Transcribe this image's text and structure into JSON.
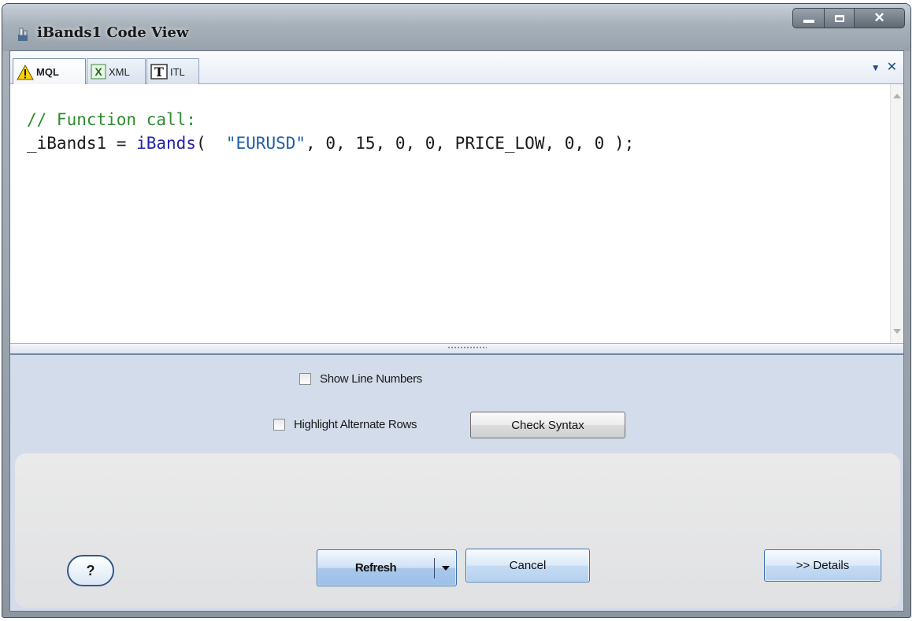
{
  "window": {
    "title": "iBands1 Code View"
  },
  "tabs": [
    {
      "label": "MQL",
      "icon": "warning-icon"
    },
    {
      "label": "XML",
      "icon": "excel-icon"
    },
    {
      "label": "ITL",
      "icon": "text-icon"
    }
  ],
  "editor": {
    "line1_comment": "// Function call:",
    "line2_var": "_iBands1 = ",
    "line2_func": "iBands",
    "line2_paren": "(  ",
    "line2_string": "\"EURUSD\"",
    "line2_args": ", 0, 15, 0, 0, PRICE_LOW, 0, 0 );"
  },
  "options": {
    "show_line_numbers": "Show Line Numbers",
    "highlight_alternate_rows": "Highlight Alternate Rows",
    "check_syntax": "Check Syntax"
  },
  "footer": {
    "help": "?",
    "refresh": "Refresh",
    "cancel": "Cancel",
    "details": ">> Details"
  },
  "colors": {
    "comment": "#2e8b2e",
    "function": "#2222aa",
    "string": "#1d5fa8",
    "panel": "#d2dcea"
  }
}
